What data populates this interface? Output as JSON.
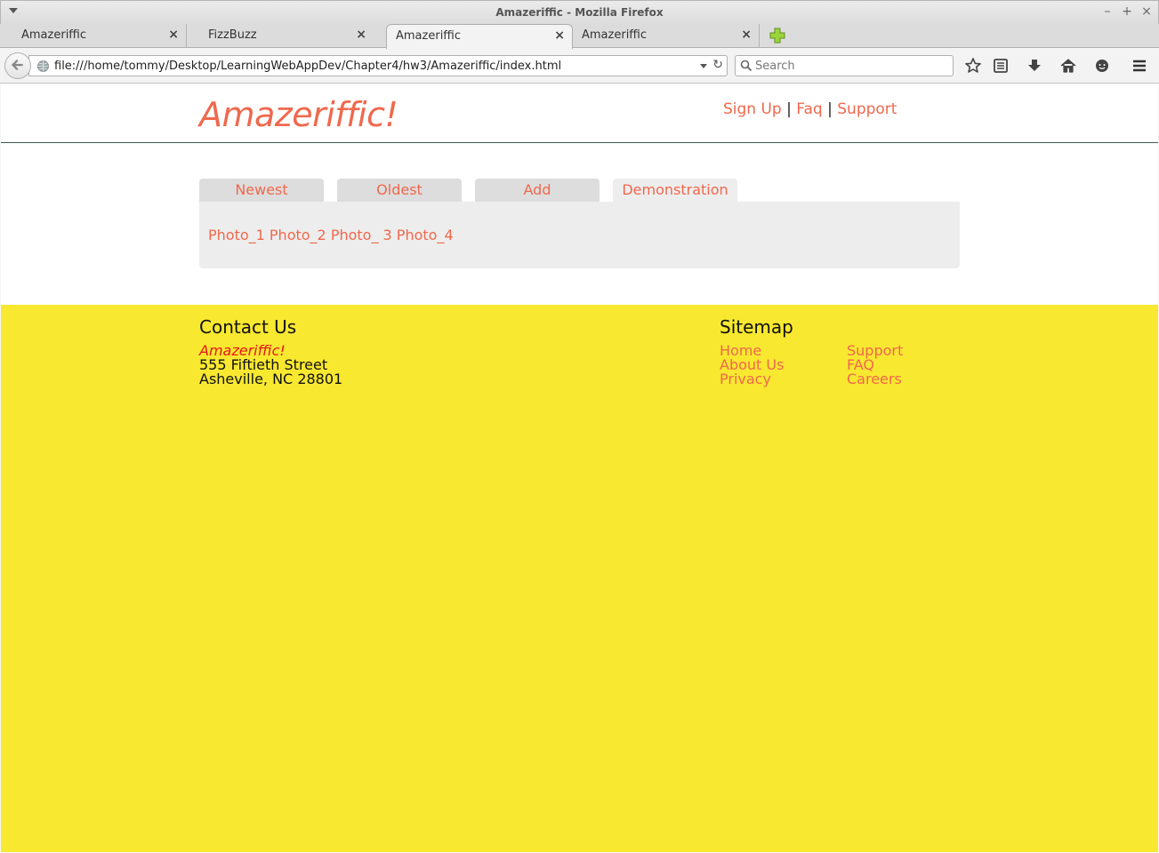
{
  "window": {
    "title": "Amazeriffic - Mozilla Firefox",
    "minimize": "–",
    "maximize": "+",
    "close": "×"
  },
  "tabs": [
    {
      "label": "Amazeriffic",
      "close": "×"
    },
    {
      "label": "FizzBuzz",
      "close": "×"
    },
    {
      "label": "Amazeriffic",
      "close": "×"
    },
    {
      "label": "Amazeriffic",
      "close": "×"
    }
  ],
  "active_tab_index": 2,
  "navbar": {
    "url": "file:///home/tommy/Desktop/LearningWebAppDev/Chapter4/hw3/Amazeriffic/index.html",
    "reload": "↻",
    "search_placeholder": "Search"
  },
  "site": {
    "logo": "Amazeriffic!",
    "nav": {
      "signup": "Sign Up",
      "sep1": " | ",
      "faq": "Faq",
      "sep2": " | ",
      "support": "Support"
    },
    "tabs": [
      "Newest",
      "Oldest",
      "Add",
      "Demonstration"
    ],
    "active_tab": "Demonstration",
    "content_text": "Photo_1 Photo_2 Photo_ 3 Photo_4"
  },
  "footer": {
    "contact_title": "Contact Us",
    "company": "Amazeriffic!",
    "street": "555 Fiftieth Street",
    "city": "Asheville, NC 28801",
    "sitemap_title": "Sitemap",
    "sitemap_col1": [
      "Home",
      "About Us",
      "Privacy"
    ],
    "sitemap_col2": [
      "Support",
      "FAQ",
      "Careers"
    ]
  },
  "colors": {
    "accent": "#f0684d",
    "footer_bg": "#f8e830",
    "company_red": "#e8161a"
  }
}
